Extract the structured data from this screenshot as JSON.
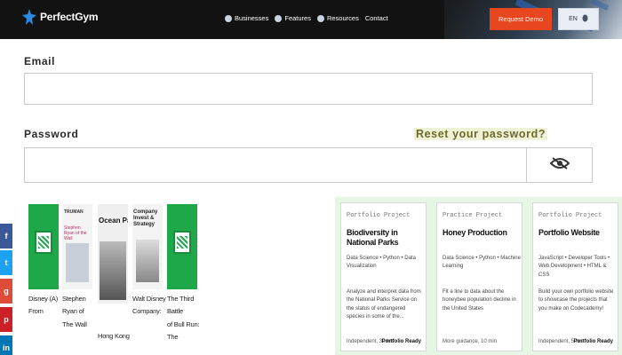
{
  "header": {
    "logo_text": "PerfectGym",
    "nav": [
      {
        "label": "Businesses",
        "icon": "globe-icon"
      },
      {
        "label": "Features",
        "icon": "globe-icon"
      },
      {
        "label": "Resources",
        "icon": "globe-icon"
      },
      {
        "label": "Contact"
      }
    ],
    "demo_label": "Request Demo",
    "lang_label": "EN"
  },
  "form": {
    "email_label": "Email",
    "email_value": "",
    "password_label": "Password",
    "password_value": "",
    "reset_label": "Reset your password?",
    "toggle_icon": "eye-slash-icon"
  },
  "social": [
    {
      "icon": "facebook-icon",
      "glyph": "f",
      "color": "#3b5998"
    },
    {
      "icon": "twitter-icon",
      "glyph": "t",
      "color": "#1da1f2"
    },
    {
      "icon": "google-plus-icon",
      "glyph": "g",
      "color": "#dd4b39"
    },
    {
      "icon": "pinterest-icon",
      "glyph": "p",
      "color": "#cb2027"
    },
    {
      "icon": "linkedin-icon",
      "glyph": "in",
      "color": "#0077b5"
    }
  ],
  "books": [
    {
      "cover_text": "",
      "caption": [
        "Disney (A)",
        "From"
      ]
    },
    {
      "cover_text": "TRUMAN | Stephen Ryan of the Wall",
      "caption": [
        "Stephen Ryan of",
        "The Wall"
      ]
    },
    {
      "cover_text": "Ocean Park Tai",
      "caption": [
        "Hong Kong"
      ]
    },
    {
      "cover_text": "Company Invest & Strategy Walt Disney",
      "caption": [
        "Walt Disney",
        "Company:"
      ]
    },
    {
      "cover_text": "",
      "caption": [
        "The Third Battle",
        "of Bull Run: The"
      ]
    }
  ],
  "cards": [
    {
      "tag": "Portfolio Project",
      "title": "Biodiversity in National Parks",
      "skills": "Data Science • Python • Data Visualization",
      "desc": "Analyze and interpret data from the National Parks Service on the status of endangered species in some of the...",
      "meta": "Independent, 30 hrs",
      "ready": "Portfolio Ready"
    },
    {
      "tag": "Practice Project",
      "title": "Honey Production",
      "skills": "Data Science • Python • Machine Learning",
      "desc": "Fit a line to data about the honeybee population decline in the United States",
      "meta": "More guidance, 10 min",
      "ready": ""
    },
    {
      "tag": "Portfolio Project",
      "title": "Portfolio Website",
      "skills": "JavaScript • Developer Tools • Web Development • HTML & CSS",
      "desc": "Build your own portfolio website to showcase the projects that you make on Codecademy!",
      "meta": "Independent, 5 hrs",
      "ready": "Portfolio Ready"
    }
  ],
  "colors": {
    "header_bg": "#121212",
    "demo_button": "#e8461e",
    "cards_panel_bg": "#e6f7e6",
    "book_green": "#1ea84a"
  }
}
